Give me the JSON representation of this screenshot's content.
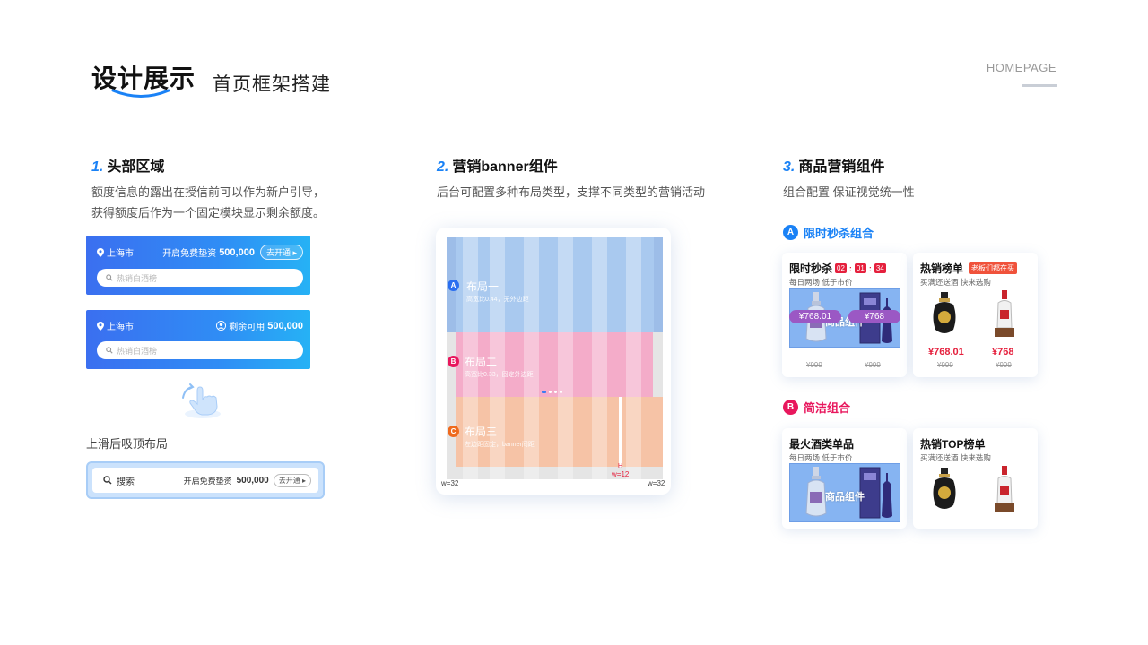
{
  "header": {
    "title": "设计展示",
    "subtitle": "首页框架搭建",
    "right_label": "HOMEPAGE"
  },
  "section1": {
    "num": "1.",
    "title": "头部区域",
    "desc_line1": "额度信息的露出在授信前可以作为新户引导，",
    "desc_line2": "获得额度后作为一个固定模块显示剩余额度。",
    "bar1": {
      "city": "上海市",
      "text": "开启免费垫资",
      "amount": "500,000",
      "button": "去开通",
      "placeholder": "热销白酒榜"
    },
    "bar2": {
      "city": "上海市",
      "text": "剩余可用",
      "amount": "500,000",
      "placeholder": "热销白酒榜"
    },
    "sticky_label": "上滑后吸顶布局",
    "sticky": {
      "search": "搜索",
      "text": "开启免费垫资",
      "amount": "500,000",
      "button": "去开通"
    }
  },
  "section2": {
    "num": "2.",
    "title": "营销banner组件",
    "desc": "后台可配置多种布局类型，支撑不同类型的营销活动",
    "layouts": [
      {
        "letter": "A",
        "title": "布局一",
        "sub": "高宽比0.44，无外边距"
      },
      {
        "letter": "B",
        "title": "布局二",
        "sub": "高宽比0.33，固定外边距"
      },
      {
        "letter": "C",
        "title": "布局三",
        "sub": "左边距固定，banner间距"
      }
    ],
    "w_left": "w=32",
    "w_right": "w=32",
    "w_mid": "w=12",
    "h_label": "H"
  },
  "section3": {
    "num": "3.",
    "title": "商品营销组件",
    "desc": "组合配置 保证视觉统一性",
    "groupA": {
      "letter": "A",
      "label": "限时秒杀组合",
      "card1": {
        "title": "限时秒杀",
        "t1": "02",
        "t2": "01",
        "t3": "34",
        "sub": "每日两场 低于市价",
        "comp": "商品组件",
        "price1": "¥768.01",
        "price2": "¥768",
        "old1": "¥999",
        "old2": "¥999"
      },
      "card2": {
        "title": "热销榜单",
        "badge": "老板们都在买",
        "sub": "买满还送酒 快来选购",
        "price1": "¥768.01",
        "price2": "¥768",
        "old1": "¥999",
        "old2": "¥999"
      }
    },
    "groupB": {
      "letter": "B",
      "label": "简洁组合",
      "card1": {
        "title": "最火酒类单品",
        "sub": "每日两场 低于市价",
        "comp": "商品组件"
      },
      "card2": {
        "title": "热销TOP榜单",
        "sub": "买满还送酒 快来选购"
      }
    }
  },
  "colors": {
    "accent": "#1a82f6",
    "pink": "#e8175d",
    "red": "#e5203d"
  }
}
